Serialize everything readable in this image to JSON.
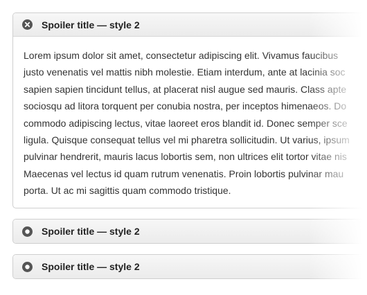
{
  "spoilers": [
    {
      "title": "Spoiler title — style 2",
      "state": "open",
      "icon": "close-icon",
      "content_lines": [
        "Lorem ipsum dolor sit amet, consectetur adipiscing elit. Vivamus faucibus",
        "justo venenatis vel mattis nibh molestie. Etiam interdum, ante at lacinia soc",
        "sapien sapien tincidunt tellus, at placerat nisl augue sed mauris. Class apte",
        "sociosqu ad litora torquent per conubia nostra, per inceptos himenaeos. Do",
        "commodo adipiscing lectus, vitae laoreet eros blandit id. Donec semper sce",
        "ligula. Quisque consequat tellus vel mi pharetra sollicitudin. Ut varius, ipsum",
        "pulvinar hendrerit, mauris lacus lobortis sem, non ultrices elit tortor vitae nis",
        "Maecenas vel lectus id quam rutrum venenatis. Proin lobortis pulvinar mau",
        "porta. Ut ac mi sagittis quam commodo tristique."
      ]
    },
    {
      "title": "Spoiler title — style 2",
      "state": "closed",
      "icon": "radio-dot-icon"
    },
    {
      "title": "Spoiler title — style 2",
      "state": "closed",
      "icon": "radio-dot-icon"
    }
  ],
  "colors": {
    "icon_dark": "#555555",
    "border": "#cfcfcf",
    "title": "#222222",
    "text": "#333333"
  }
}
